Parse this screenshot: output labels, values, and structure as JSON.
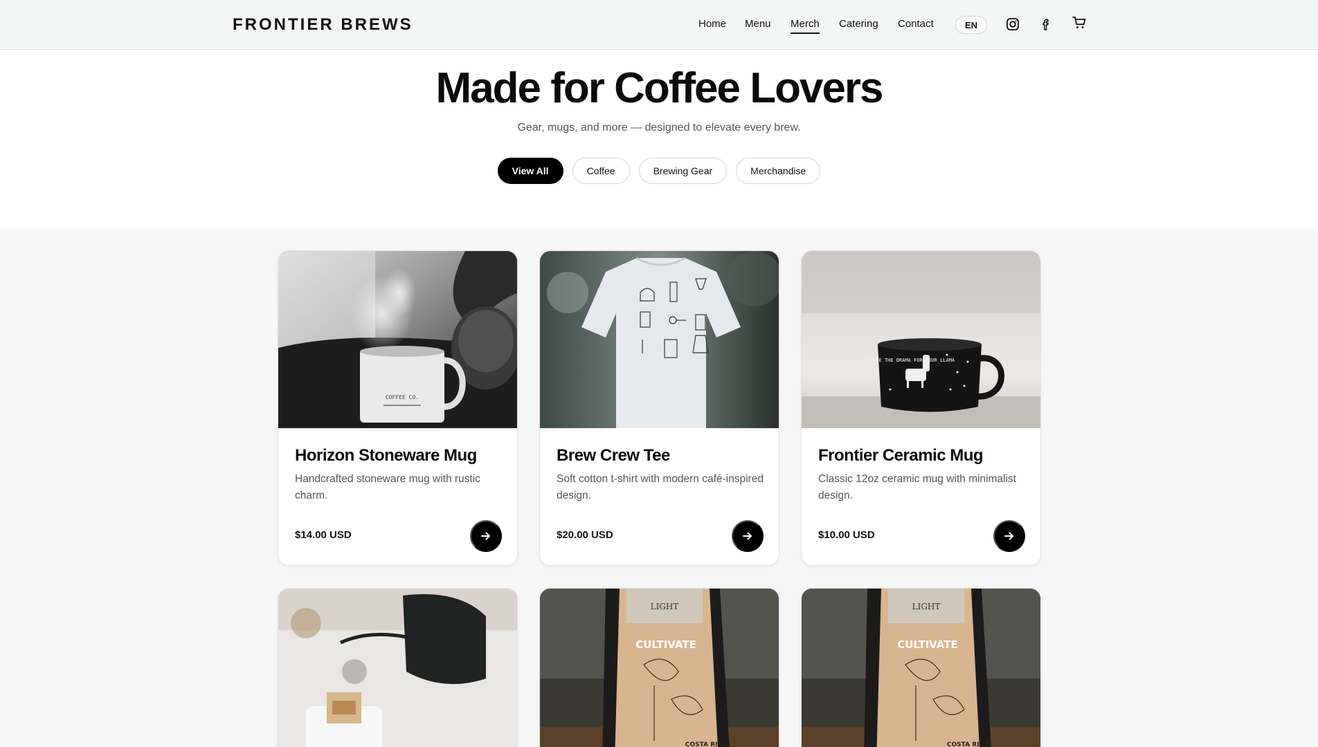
{
  "header": {
    "brand": "FRONTIER BREWS",
    "nav": [
      {
        "label": "Home",
        "active": false
      },
      {
        "label": "Menu",
        "active": false
      },
      {
        "label": "Merch",
        "active": true
      },
      {
        "label": "Catering",
        "active": false
      },
      {
        "label": "Contact",
        "active": false
      }
    ],
    "language": "EN",
    "icons": [
      "instagram-icon",
      "facebook-icon",
      "cart-icon"
    ]
  },
  "hero": {
    "title": "Made for Coffee Lovers",
    "subtitle": "Gear, mugs, and more — designed to elevate every brew."
  },
  "filters": [
    {
      "label": "View All",
      "active": true
    },
    {
      "label": "Coffee",
      "active": false
    },
    {
      "label": "Brewing Gear",
      "active": false
    },
    {
      "label": "Merchandise",
      "active": false
    }
  ],
  "products": [
    {
      "title": "Horizon Stoneware Mug",
      "description": "Handcrafted stoneware mug with rustic charm.",
      "price": "$14.00 USD",
      "mug_print": "COFFEE CO."
    },
    {
      "title": "Brew Crew Tee",
      "description": "Soft cotton t-shirt with modern café-inspired design.",
      "price": "$20.00 USD"
    },
    {
      "title": "Frontier Ceramic Mug",
      "description": "Classic 12oz ceramic mug with minimalist design.",
      "price": "$10.00 USD",
      "mug_print": "SAVE THE DRAMA FOR YOUR LLAMA"
    }
  ],
  "products_row2": [
    {
      "image": "gooseneck-kettle-pour-over-photo"
    },
    {
      "image": "coffee-bag-photo",
      "bag_top": "LIGHT",
      "bag_brand": "CULTIVATE",
      "bag_origin": "COSTA RICA"
    },
    {
      "image": "coffee-bag-photo",
      "bag_top": "LIGHT",
      "bag_brand": "CULTIVATE",
      "bag_origin": "COSTA RICA"
    }
  ],
  "colors": {
    "accent": "#000000",
    "page_bg": "#ffffff",
    "grid_bg": "#f6f6f6",
    "header_bg": "#f4f5f5"
  }
}
